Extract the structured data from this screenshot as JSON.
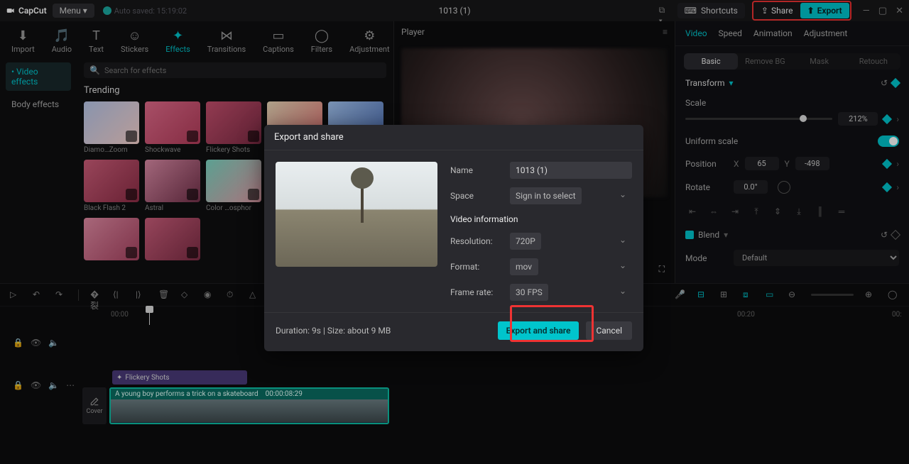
{
  "app": {
    "name": "CapCut",
    "menu": "Menu",
    "autosaved": "Auto saved: 15:19:02",
    "project_title": "1013 (1)"
  },
  "topbar": {
    "shortcuts": "Shortcuts",
    "share": "Share",
    "export": "Export"
  },
  "tabs": [
    "Import",
    "Audio",
    "Text",
    "Stickers",
    "Effects",
    "Transitions",
    "Captions",
    "Filters",
    "Adjustment"
  ],
  "active_tab": "Effects",
  "effects_sidebar": {
    "items": [
      "Video effects",
      "Body effects"
    ],
    "active": 0
  },
  "search": {
    "placeholder": "Search for effects"
  },
  "effects_section": "Trending",
  "effects": [
    {
      "label": "Diamo…Zoom",
      "g": "g1"
    },
    {
      "label": "Shockwave",
      "g": "g2"
    },
    {
      "label": "Flickery Shots",
      "g": "g3"
    },
    {
      "label": "",
      "g": "g4"
    },
    {
      "label": "",
      "g": "g5"
    },
    {
      "label": "Black Flash 2",
      "g": "g6"
    },
    {
      "label": "Astral",
      "g": "g7"
    },
    {
      "label": "Color …osphor",
      "g": "g8"
    },
    {
      "label": "",
      "g": "g9"
    },
    {
      "label": "",
      "g": "g10"
    },
    {
      "label": "",
      "g": "g11"
    },
    {
      "label": "",
      "g": "g12"
    }
  ],
  "player": {
    "title": "Player"
  },
  "props": {
    "tabs": [
      "Video",
      "Speed",
      "Animation",
      "Adjustment"
    ],
    "active": 0,
    "subtabs": [
      "Basic",
      "Remove BG",
      "Mask",
      "Retouch"
    ],
    "subactive": 0,
    "transform": "Transform",
    "scale_label": "Scale",
    "scale_value": "212%",
    "uniform_label": "Uniform scale",
    "position_label": "Position",
    "pos_x": "65",
    "pos_y": "-498",
    "rotate_label": "Rotate",
    "rotate_value": "0.0°",
    "blend_label": "Blend",
    "mode_label": "Mode",
    "mode_value": "Default"
  },
  "ruler": {
    "t0": "00:00",
    "t1": "00:20",
    "t2": "00:"
  },
  "timeline": {
    "effect_clip": "Flickery Shots",
    "video_label": "A young boy performs a trick on a skateboard",
    "video_time": "00:00:08:29",
    "cover": "Cover"
  },
  "modal": {
    "title": "Export and share",
    "name_label": "Name",
    "name_value": "1013 (1)",
    "space_label": "Space",
    "space_value": "Sign in to select",
    "vinfo": "Video information",
    "res_label": "Resolution:",
    "res_value": "720P",
    "fmt_label": "Format:",
    "fmt_value": "mov",
    "fr_label": "Frame rate:",
    "fr_value": "30 FPS",
    "footer_info": "Duration: 9s | Size: about 9 MB",
    "confirm": "Export and share",
    "cancel": "Cancel"
  }
}
